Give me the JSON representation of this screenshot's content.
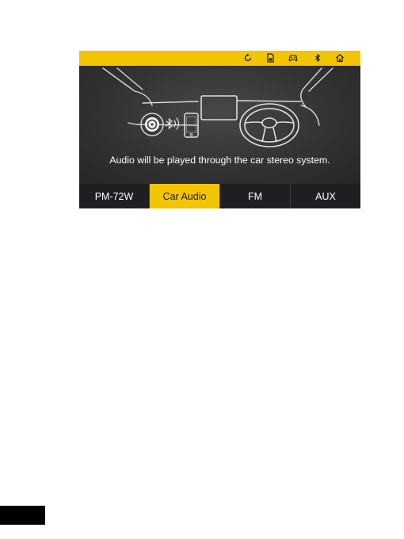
{
  "topbar": {
    "icons": [
      "refresh-icon",
      "sd-card-icon",
      "gamepad-icon",
      "bluetooth-icon",
      "home-icon"
    ],
    "color": "#f2c500"
  },
  "main": {
    "message": "Audio will be played through the car stereo system."
  },
  "tabs": [
    {
      "label": "PM-72W",
      "active": false
    },
    {
      "label": "Car Audio",
      "active": true
    },
    {
      "label": "FM",
      "active": false
    },
    {
      "label": "AUX",
      "active": false
    }
  ],
  "colors": {
    "accent": "#f2c500",
    "tab_background": "#1d1f22",
    "screen_background": "#333333"
  }
}
